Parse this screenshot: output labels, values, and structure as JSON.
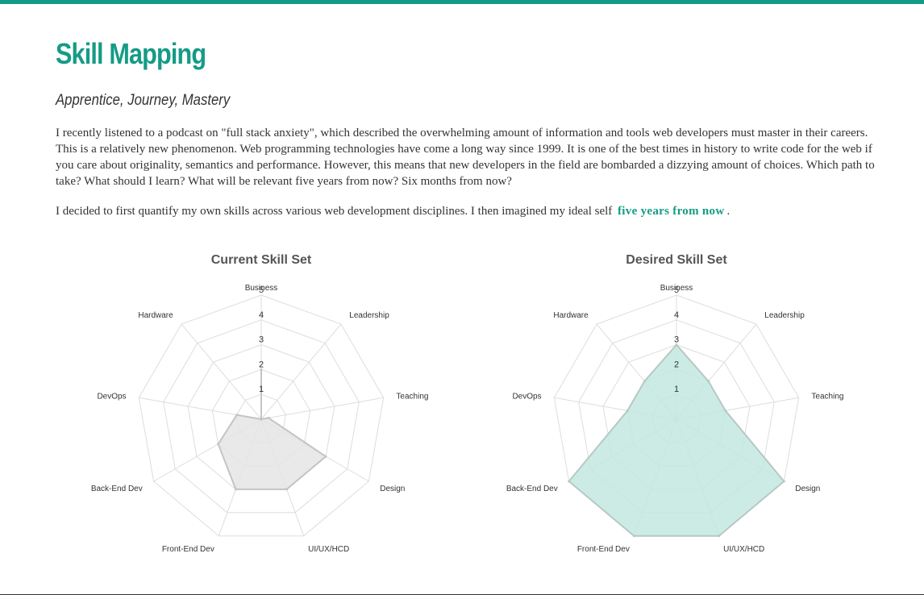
{
  "page": {
    "title": "Skill Mapping",
    "subtitle": "Apprentice, Journey, Mastery",
    "paragraph1": "I recently listened to a podcast on \"full stack anxiety\", which described the overwhelming amount of information and tools web developers must master in their careers. This is a relatively new phenomenon. Web programming technologies have come a long way since 1999. It is one of the best times in history to write code for the web if you care about originality, semantics and performance. However, this means that new developers in the field are bombarded a dizzying amount of choices. Which path to take? What should I learn? What will be relevant five years from now? Six months from now?",
    "paragraph2_before": "I decided to first quantify my own skills across various web development disciplines. I then imagined my ideal self",
    "paragraph2_link": "five years from now",
    "paragraph2_after": "."
  },
  "colors": {
    "accent": "#149b86",
    "current_fill": "#e5e5e5",
    "current_stroke": "#c4c4c4",
    "desired_fill": "#c3e8e1",
    "desired_stroke": "#b5c9c4",
    "grid": "#dddddd"
  },
  "chart_data": [
    {
      "type": "radar",
      "title": "Current Skill Set",
      "axes": [
        "Business",
        "Leadership",
        "Teaching",
        "Design",
        "UI/UX/HCD",
        "Front-End Dev",
        "Back-End Dev",
        "DevOps",
        "Hardware"
      ],
      "values": [
        2,
        0,
        0.3,
        3,
        3,
        3,
        2,
        1,
        0
      ],
      "rlim": [
        0,
        5
      ],
      "ticks": [
        1,
        2,
        3,
        4,
        5
      ],
      "grid": true
    },
    {
      "type": "radar",
      "title": "Desired Skill Set",
      "axes": [
        "Business",
        "Leadership",
        "Teaching",
        "Design",
        "UI/UX/HCD",
        "Front-End Dev",
        "Back-End Dev",
        "DevOps",
        "Hardware"
      ],
      "values": [
        3,
        2,
        2,
        5,
        5,
        5,
        5,
        2,
        2
      ],
      "rlim": [
        0,
        5
      ],
      "ticks": [
        1,
        2,
        3,
        4,
        5
      ],
      "grid": true
    }
  ]
}
